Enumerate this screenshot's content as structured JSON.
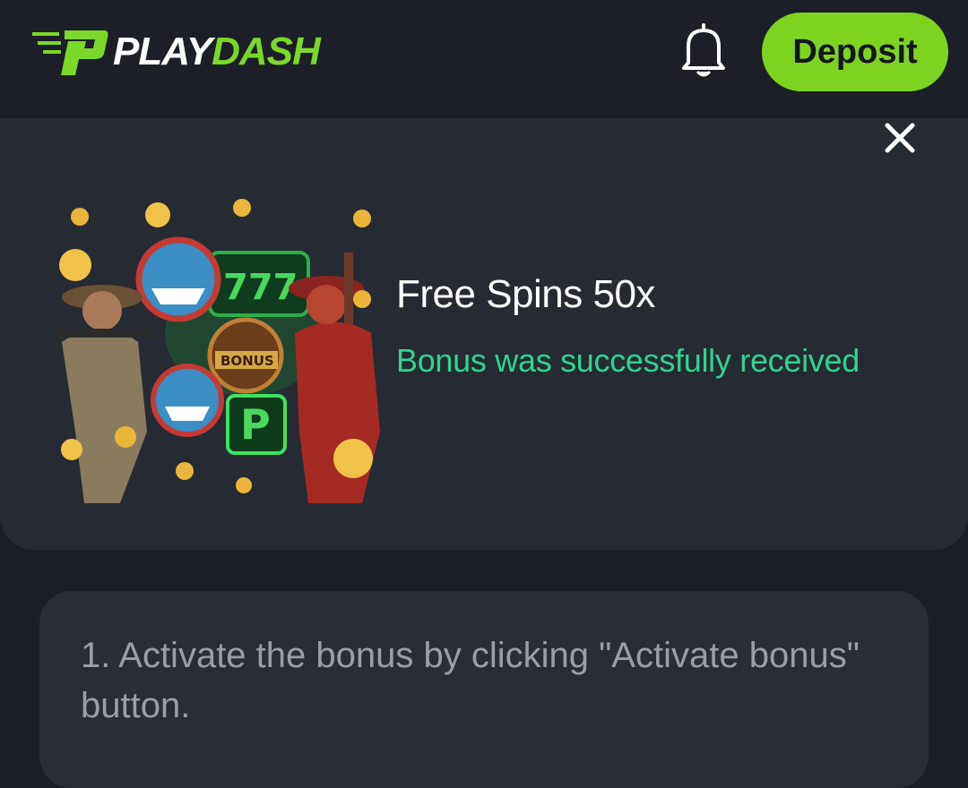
{
  "header": {
    "brand_play": "PLAY",
    "brand_dash": "DASH",
    "deposit_label": "Deposit"
  },
  "modal": {
    "title": "Free Spins 50x",
    "status": "Bonus was successfully received"
  },
  "instructions": {
    "step1": "1. Activate the bonus by clicking \"Activate bonus\" button."
  },
  "icons": {
    "logo": "playdash-logo-icon",
    "bell": "bell-icon",
    "close": "close-icon"
  },
  "colors": {
    "accent": "#7ed321",
    "status_green": "#2fd58e",
    "background": "#1b1e26"
  }
}
